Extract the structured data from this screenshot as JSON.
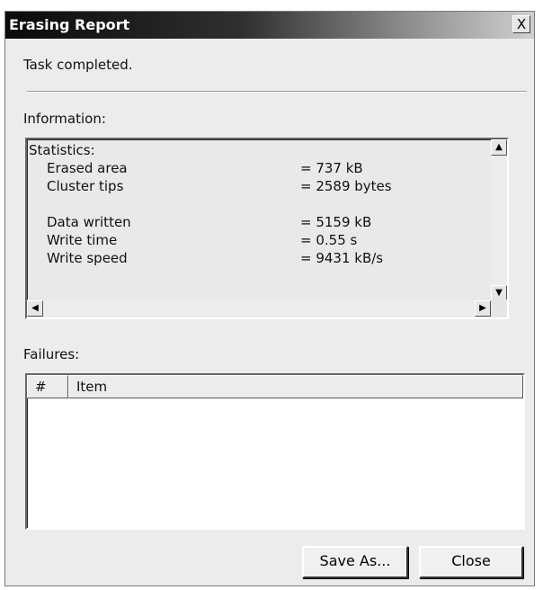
{
  "window": {
    "title": "Erasing Report",
    "close_glyph": "X"
  },
  "status_text": "Task completed.",
  "information": {
    "label": "Information:",
    "heading": "Statistics:",
    "rows": [
      {
        "name": "Erased area",
        "value": "= 737 kB"
      },
      {
        "name": "Cluster tips",
        "value": "= 2589 bytes"
      },
      {
        "name": "Data written",
        "value": "= 5159 kB"
      },
      {
        "name": "Write time",
        "value": "= 0.55 s"
      },
      {
        "name": "Write speed",
        "value": "= 9431 kB/s"
      }
    ]
  },
  "failures": {
    "label": "Failures:",
    "columns": [
      "#",
      "Item"
    ]
  },
  "buttons": {
    "save_as": "Save As...",
    "close": "Close"
  }
}
